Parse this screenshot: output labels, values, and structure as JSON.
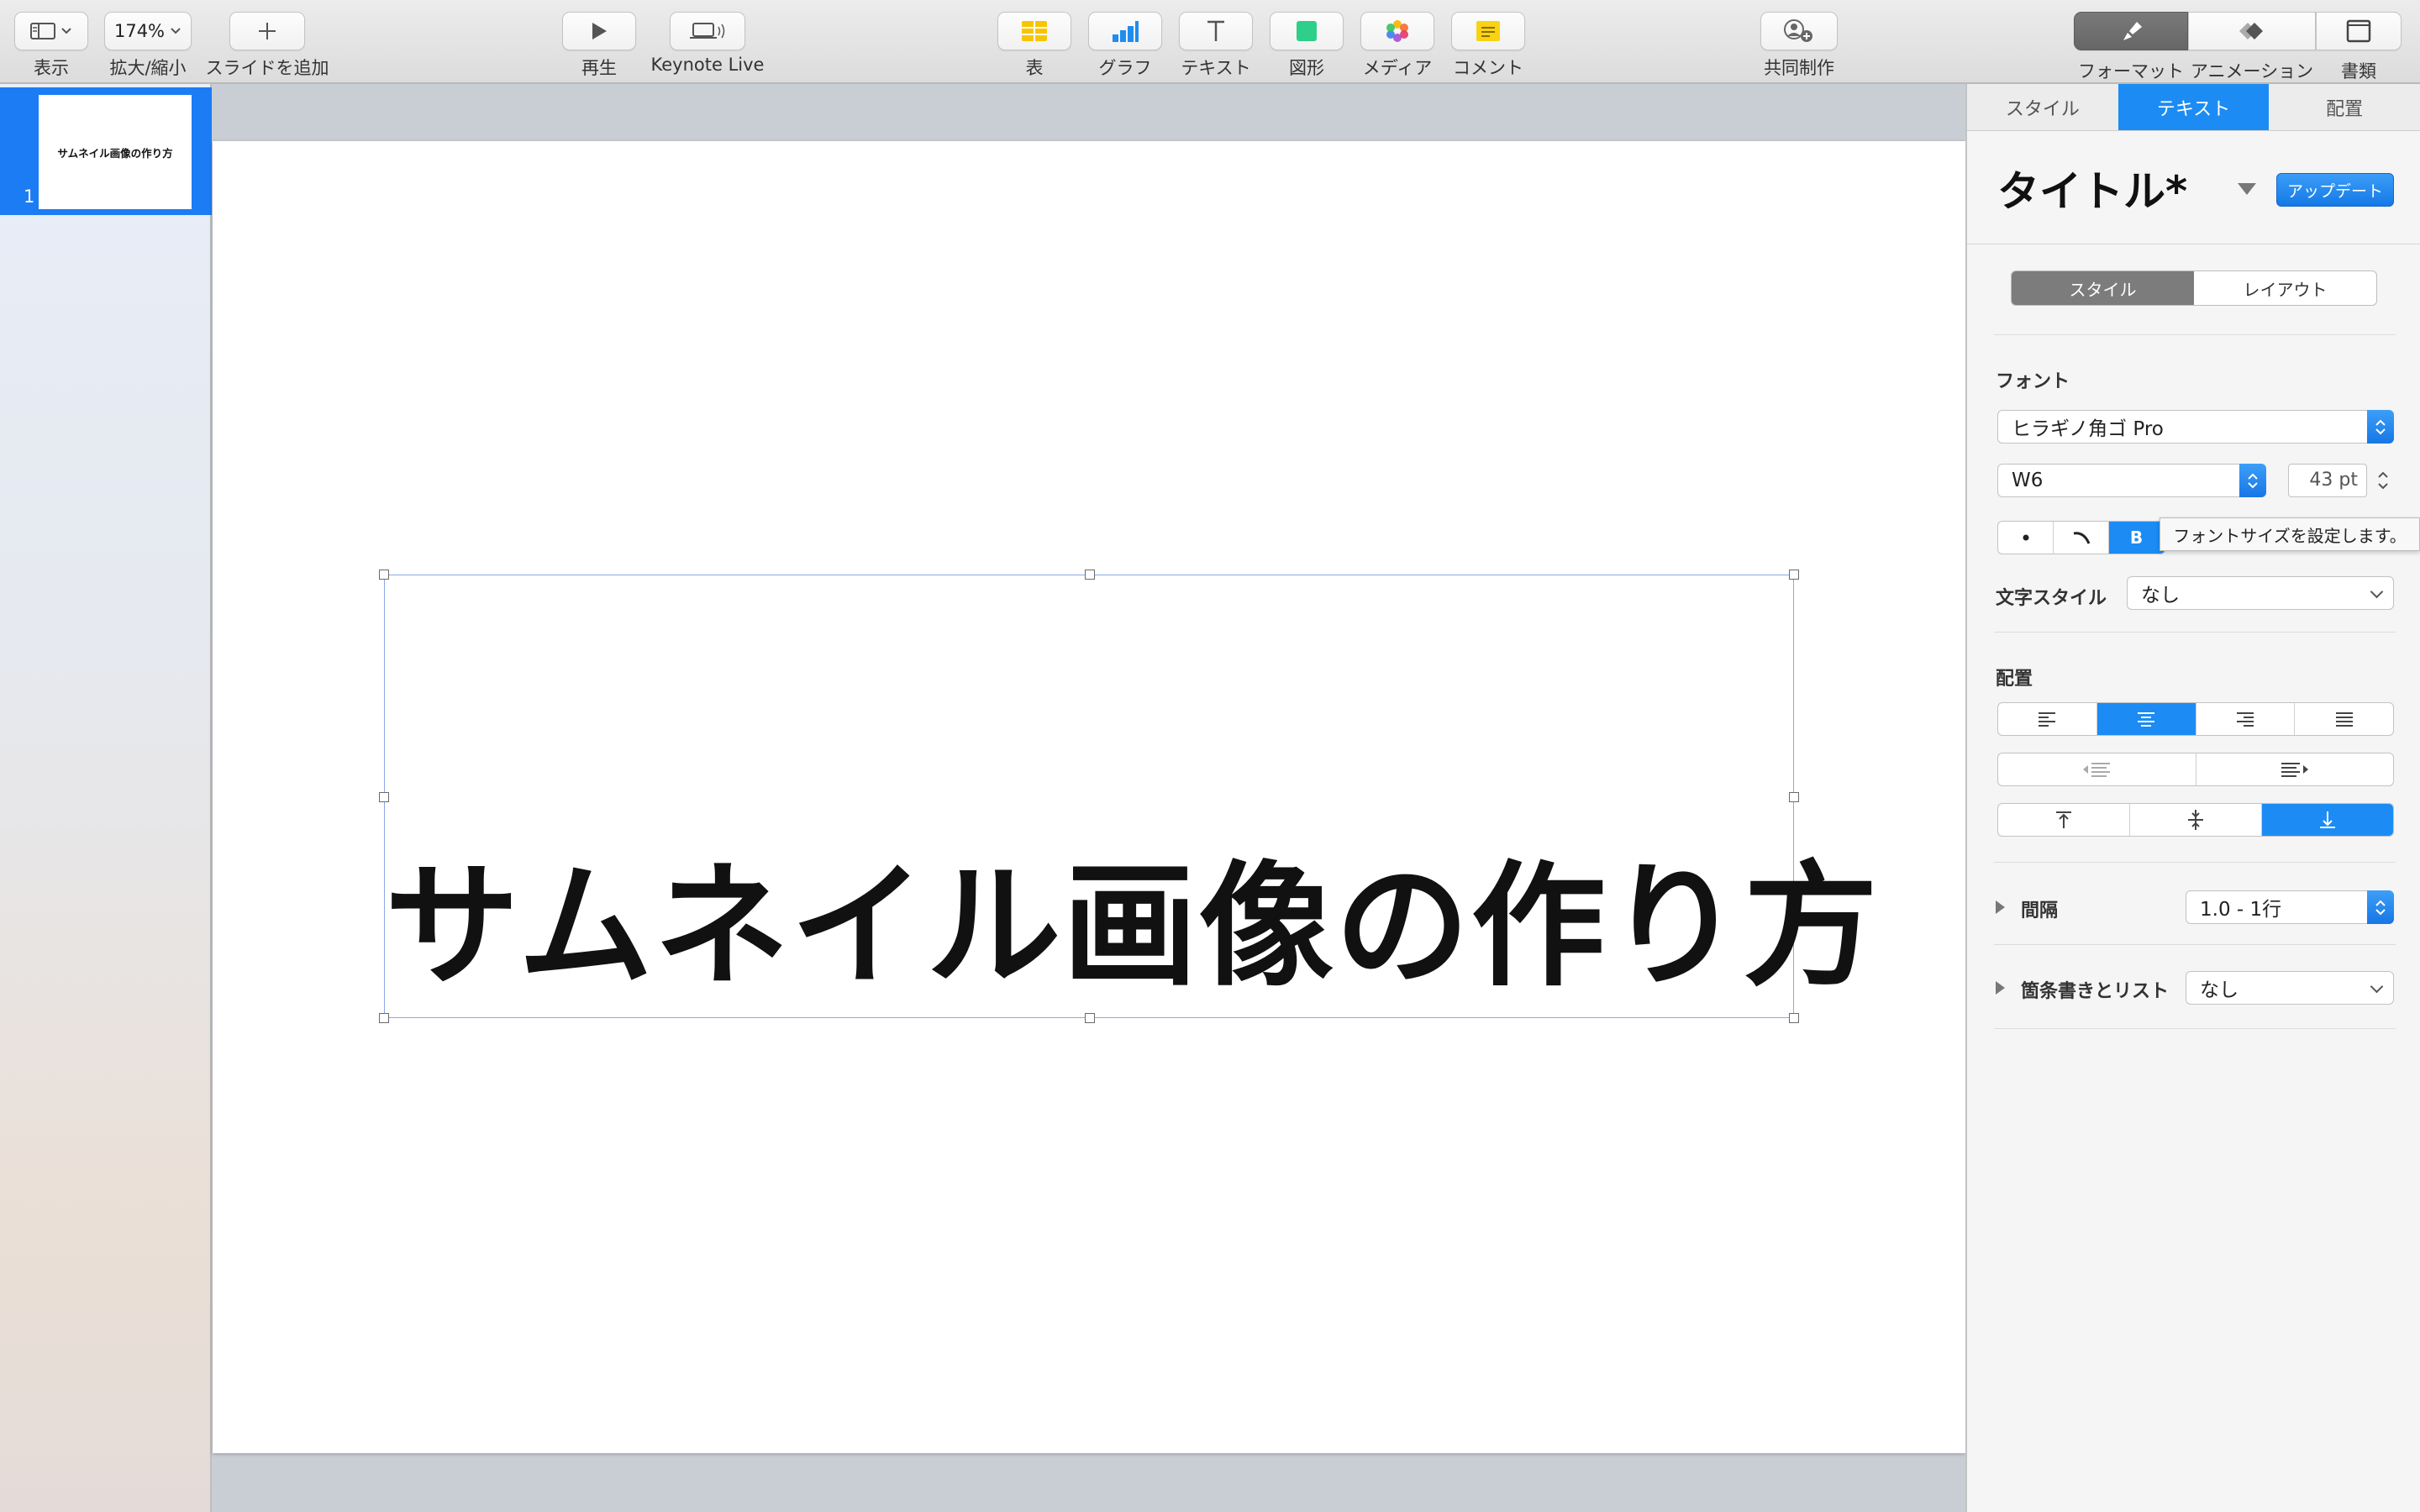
{
  "toolbar": {
    "view": "表示",
    "zoom_value": "174%",
    "zoom": "拡大/縮小",
    "add_slide": "スライドを追加",
    "play": "再生",
    "keynote_live": "Keynote Live",
    "table": "表",
    "chart": "グラフ",
    "text": "テキスト",
    "shape": "図形",
    "media": "メディア",
    "comment": "コメント",
    "collaborate": "共同制作",
    "format": "フォーマット",
    "animate": "アニメーション",
    "document": "書類"
  },
  "navigator": {
    "slides": [
      {
        "number": "1",
        "thumb_text": "サムネイル画像の作り方"
      }
    ]
  },
  "slide": {
    "title": "サムネイル画像の作り方"
  },
  "inspector": {
    "tabs": [
      "スタイル",
      "テキスト",
      "配置"
    ],
    "active_tab": "テキスト",
    "style_name": "タイトル*",
    "update_button": "アップデート",
    "subtabs": [
      "スタイル",
      "レイアウト"
    ],
    "font_label": "フォント",
    "font_family": "ヒラギノ角ゴ Pro",
    "font_weight": "W6",
    "font_size": "43 pt",
    "bold_label": "B",
    "tooltip": "フォントサイズを設定します。",
    "char_style_label": "文字スタイル",
    "char_style_value": "なし",
    "alignment_label": "配置",
    "spacing_label": "間隔",
    "spacing_value": "1.0 - 1行",
    "bullets_label": "箇条書きとリスト",
    "bullets_value": "なし"
  },
  "colors": {
    "accent": "#1c8cf4",
    "selection": "#1c7cf4"
  }
}
